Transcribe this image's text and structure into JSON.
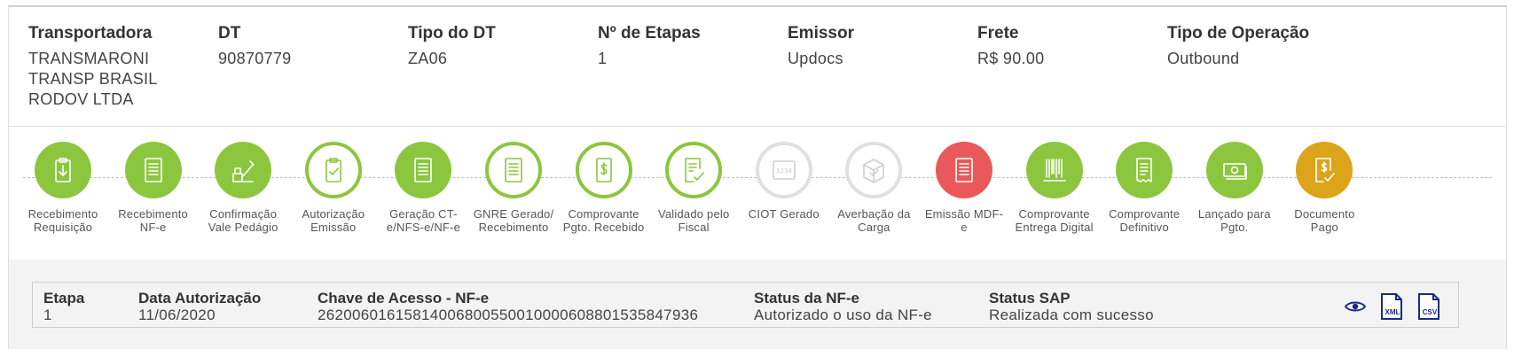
{
  "header": [
    {
      "label": "Transportadora",
      "value_lines": [
        "TRANSMARONI",
        "TRANSP BRASIL",
        "RODOV LTDA"
      ]
    },
    {
      "label": "DT",
      "value_lines": [
        "90870779"
      ]
    },
    {
      "label": "Tipo do DT",
      "value_lines": [
        "ZA06"
      ]
    },
    {
      "label": "Nº de Etapas",
      "value_lines": [
        "1"
      ]
    },
    {
      "label": "Emissor",
      "value_lines": [
        "Updocs"
      ]
    },
    {
      "label": "Frete",
      "value_lines": [
        "R$ 90.00"
      ]
    },
    {
      "label": "Tipo de Operação",
      "value_lines": [
        "Outbound"
      ]
    }
  ],
  "steps": [
    {
      "label_lines": [
        "Recebimento",
        "Requisição"
      ],
      "state": "done",
      "icon": "clipboard-download-icon"
    },
    {
      "label_lines": [
        "Recebimento",
        "NF-e"
      ],
      "state": "done",
      "icon": "document-lines-icon"
    },
    {
      "label_lines": [
        "Confirmação",
        "Vale Pedágio"
      ],
      "state": "done",
      "icon": "toll-gate-icon"
    },
    {
      "label_lines": [
        "Autorização",
        "Emissão"
      ],
      "state": "outline",
      "icon": "clipboard-check-icon"
    },
    {
      "label_lines": [
        "Geração CT-",
        "e/NFS-e/NF-e"
      ],
      "state": "done",
      "icon": "document-lines-icon"
    },
    {
      "label_lines": [
        "GNRE Gerado/",
        "Recebimento"
      ],
      "state": "outline",
      "icon": "document-lines-icon"
    },
    {
      "label_lines": [
        "Comprovante",
        "Pgto. Recebido"
      ],
      "state": "outline",
      "icon": "receipt-dollar-icon"
    },
    {
      "label_lines": [
        "Validado pelo",
        "Fiscal"
      ],
      "state": "outline",
      "icon": "document-check-icon"
    },
    {
      "label_lines": [
        "CIOT Gerado"
      ],
      "state": "pending",
      "icon": "ciot-code-icon",
      "icon_text": "1234"
    },
    {
      "label_lines": [
        "Averbação da",
        "Carga"
      ],
      "state": "pending",
      "icon": "box-check-icon"
    },
    {
      "label_lines": [
        "Emissão MDF-",
        "e"
      ],
      "state": "error",
      "icon": "document-lines-icon"
    },
    {
      "label_lines": [
        "Comprovante",
        "Entrega Digital"
      ],
      "state": "done",
      "icon": "barcode-icon"
    },
    {
      "label_lines": [
        "Comprovante",
        "Definitivo"
      ],
      "state": "done",
      "icon": "receipt-list-icon"
    },
    {
      "label_lines": [
        "Lançado para",
        "Pgto."
      ],
      "state": "done",
      "icon": "banknote-icon"
    },
    {
      "label_lines": [
        "Documento",
        "Pago"
      ],
      "state": "paid",
      "icon": "document-dollar-check-icon"
    }
  ],
  "detail": {
    "etapa": {
      "label": "Etapa",
      "value": "1"
    },
    "data": {
      "label": "Data Autorização",
      "value": "11/06/2020"
    },
    "chave": {
      "label": "Chave de Acesso - NF-e",
      "value": "26200601615814006800550010000608801535847936"
    },
    "status_nfe": {
      "label": "Status da NF-e",
      "value": "Autorizado o uso da NF-e"
    },
    "status_sap": {
      "label": "Status SAP",
      "value": "Realizada com sucesso"
    },
    "actions": [
      {
        "name": "view-icon",
        "text": ""
      },
      {
        "name": "xml-file-icon",
        "text": "XML"
      },
      {
        "name": "csv-file-icon",
        "text": "CSV"
      }
    ]
  },
  "colors": {
    "done": "#8cc63f",
    "pending": "#e0e0e0",
    "error": "#e9585a",
    "paid": "#dca418",
    "action_icon": "#1a2a8a"
  }
}
